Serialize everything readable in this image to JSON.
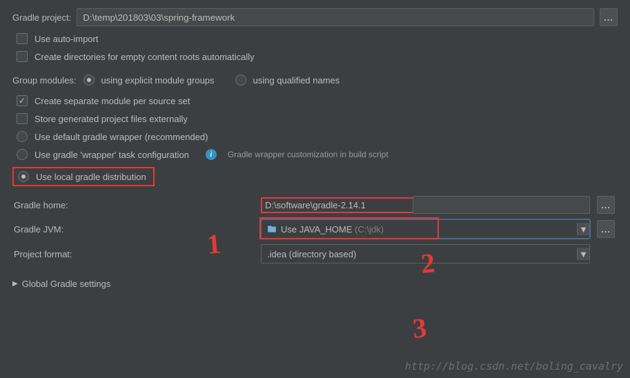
{
  "header": {
    "project_label": "Gradle project:",
    "project_path": "D:\\temp\\201803\\03\\spring-framework"
  },
  "options": {
    "auto_import": "Use auto-import",
    "create_dirs": "Create directories for empty content roots automatically",
    "group_label": "Group modules:",
    "group_explicit": "using explicit module groups",
    "group_qualified": "using qualified names",
    "separate_module": "Create separate module per source set",
    "store_external": "Store generated project files externally",
    "use_default_wrapper": "Use default gradle wrapper (recommended)",
    "use_wrapper_task": "Use gradle 'wrapper' task configuration",
    "wrapper_hint": "Gradle wrapper customization in build script",
    "use_local": "Use local gradle distribution"
  },
  "form": {
    "gradle_home_label": "Gradle home:",
    "gradle_home_value": "D:\\software\\gradle-2.14.1",
    "gradle_jvm_label": "Gradle JVM:",
    "gradle_jvm_value": "Use JAVA_HOME",
    "gradle_jvm_suffix": "(C:\\jdk)",
    "project_format_label": "Project format:",
    "project_format_value": ".idea (directory based)"
  },
  "footer": {
    "global_settings": "Global Gradle settings"
  },
  "annotations": {
    "n1": "1",
    "n2": "2",
    "n3": "3"
  },
  "watermark": "http://blog.csdn.net/boling_cavalry",
  "ellipsis": "..."
}
